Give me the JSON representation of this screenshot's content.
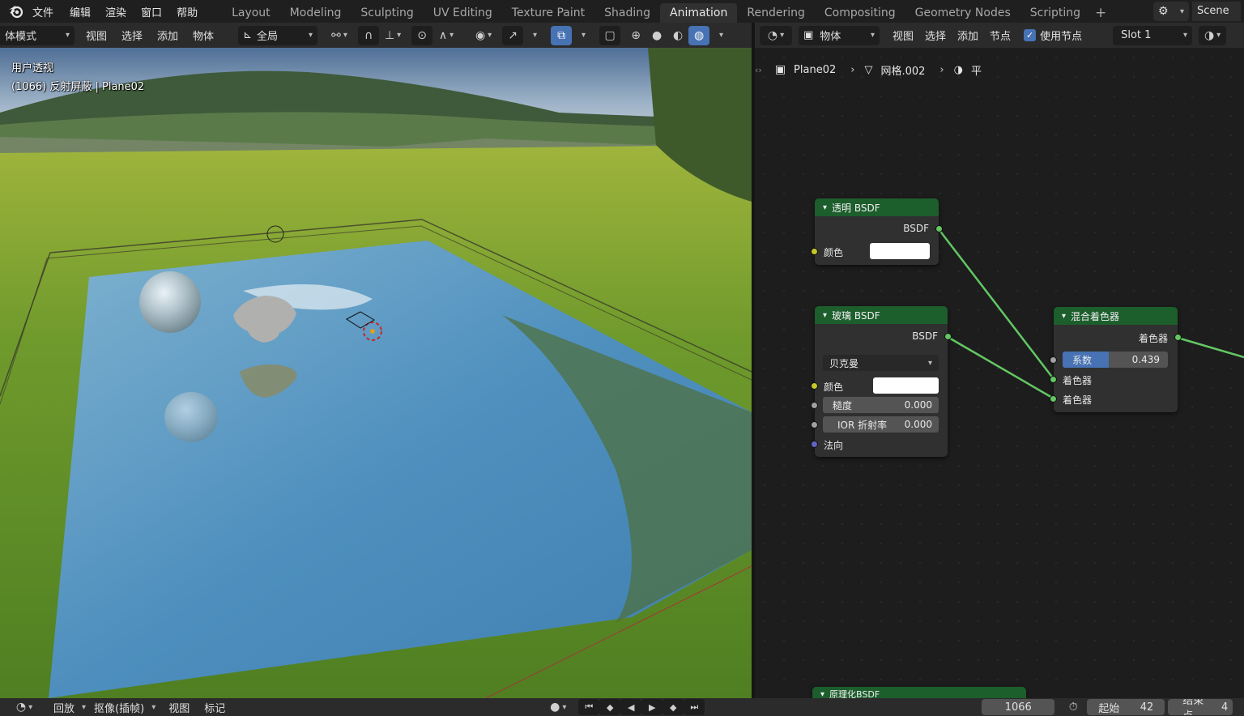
{
  "topbar": {
    "menus": [
      "文件",
      "编辑",
      "渲染",
      "窗口",
      "帮助"
    ],
    "workspaces": [
      "Layout",
      "Modeling",
      "Sculpting",
      "UV Editing",
      "Texture Paint",
      "Shading",
      "Animation",
      "Rendering",
      "Compositing",
      "Geometry Nodes",
      "Scripting"
    ],
    "active_workspace": "Animation",
    "add_tab": "+",
    "scene": "Scene"
  },
  "viewport_header": {
    "mode": "体模式",
    "menus": [
      "视图",
      "选择",
      "添加",
      "物体"
    ],
    "transform_orientation": "全局"
  },
  "viewport": {
    "overlay_title": "用户透视",
    "overlay_info": "(1066) 反射屏蔽 | Plane02"
  },
  "node_header": {
    "object_type": "物体",
    "menus": [
      "视图",
      "选择",
      "添加",
      "节点"
    ],
    "use_nodes_label": "使用节点",
    "slot": "Slot 1"
  },
  "breadcrumb": {
    "object": "Plane02",
    "mesh": "网格.002",
    "material": "平"
  },
  "nodes": {
    "transparent": {
      "title": "透明 BSDF",
      "output": "BSDF",
      "color_label": "颜色"
    },
    "glass": {
      "title": "玻璃 BSDF",
      "output": "BSDF",
      "distribution": "贝克曼",
      "color_label": "颜色",
      "roughness_label": "糙度",
      "roughness_value": "0.000",
      "ior_label": "IOR 折射率",
      "ior_value": "0.000",
      "normal_label": "法向"
    },
    "mix": {
      "title": "混合着色器",
      "output": "着色器",
      "fac_label": "系数",
      "fac_value": "0.439",
      "fac": 0.439,
      "shader1": "着色器",
      "shader2": "着色器"
    },
    "principled": {
      "title": "原理化BSDF"
    }
  },
  "timeline": {
    "menus": [
      "回放",
      "抠像(插帧)",
      "视图",
      "标记"
    ],
    "current_frame": "1066",
    "start_label": "起始",
    "start_value": "42",
    "end_label": "结束点",
    "end_value": "4"
  },
  "colors": {
    "accent": "#4772b3",
    "node_header": "#1c5e2c",
    "link": "#63c763"
  }
}
